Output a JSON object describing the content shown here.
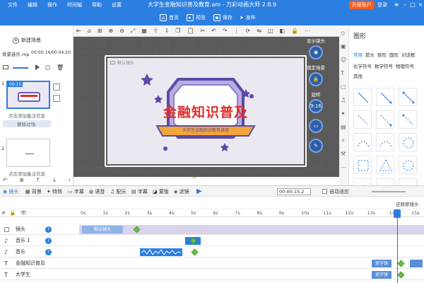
{
  "titlebar": {
    "menu": [
      "文件",
      "编辑",
      "操作",
      "时间轴",
      "帮助",
      "设置"
    ],
    "title": "大学生金融知识普及教育.am - 万彩动画大师 2.8.9",
    "upgrade": "升级账户",
    "login": "登录"
  },
  "toolbar": {
    "home": "首页",
    "preview": "预览",
    "save": "保存",
    "publish": "发布"
  },
  "scenes": {
    "new_scene": "新建场景",
    "bg_music": "背景音乐.mp",
    "bg_time": "00:00:14/00:04:20",
    "scene1_index": "1",
    "scene1_time": "00:15",
    "scene1_note": "点击添加备注信息",
    "scene1_transition": "擦除过场",
    "scene2_index": "2",
    "scene2_note": "点击添加备注信息"
  },
  "canvas": {
    "camera_label": "默认镜头",
    "main_title": "金融知识普及",
    "banner": "大学生金融知识教育讲座",
    "colors": {
      "red": "#e0302a",
      "purple": "#5a4aa8",
      "lilac": "#b9aee0",
      "banner": "#f3a53a"
    }
  },
  "canvas_side": {
    "show_camera": "显示镜头",
    "lock_scene": "锁定场景",
    "rotate": "旋转",
    "ratio": "9:16"
  },
  "rightpanel": {
    "title": "图形",
    "tabs_row1": [
      "常用",
      "箭头",
      "矩形",
      "圆形",
      "对话框"
    ],
    "tabs_row2": [
      "化学符号",
      "数学符号",
      "物理符号"
    ],
    "tabs_row3": [
      "其他"
    ]
  },
  "timeline": {
    "tools": [
      "镜头",
      "背景",
      "特效",
      "字幕",
      "语音",
      "配乐",
      "字幕",
      "蒙版",
      "滤镜"
    ],
    "time": "00:00:15.2",
    "auto_adapt": "自动适应",
    "reset_camera": "还原原镜头",
    "ruler": [
      "0s",
      "1s",
      "2s",
      "3s",
      "4s",
      "5s",
      "6s",
      "7s",
      "8s",
      "9s",
      "10s",
      "11s",
      "12s",
      "13s",
      "14s",
      "15s"
    ],
    "tracks": [
      {
        "name": "镜头",
        "bar": "默认镜头"
      },
      {
        "name": "音乐 1",
        "bar": ""
      },
      {
        "name": "音乐",
        "bar": ""
      },
      {
        "name": "金融知识普及",
        "bar": "逐字弹"
      },
      {
        "name": "大学生",
        "bar": "逐字弹"
      }
    ]
  }
}
